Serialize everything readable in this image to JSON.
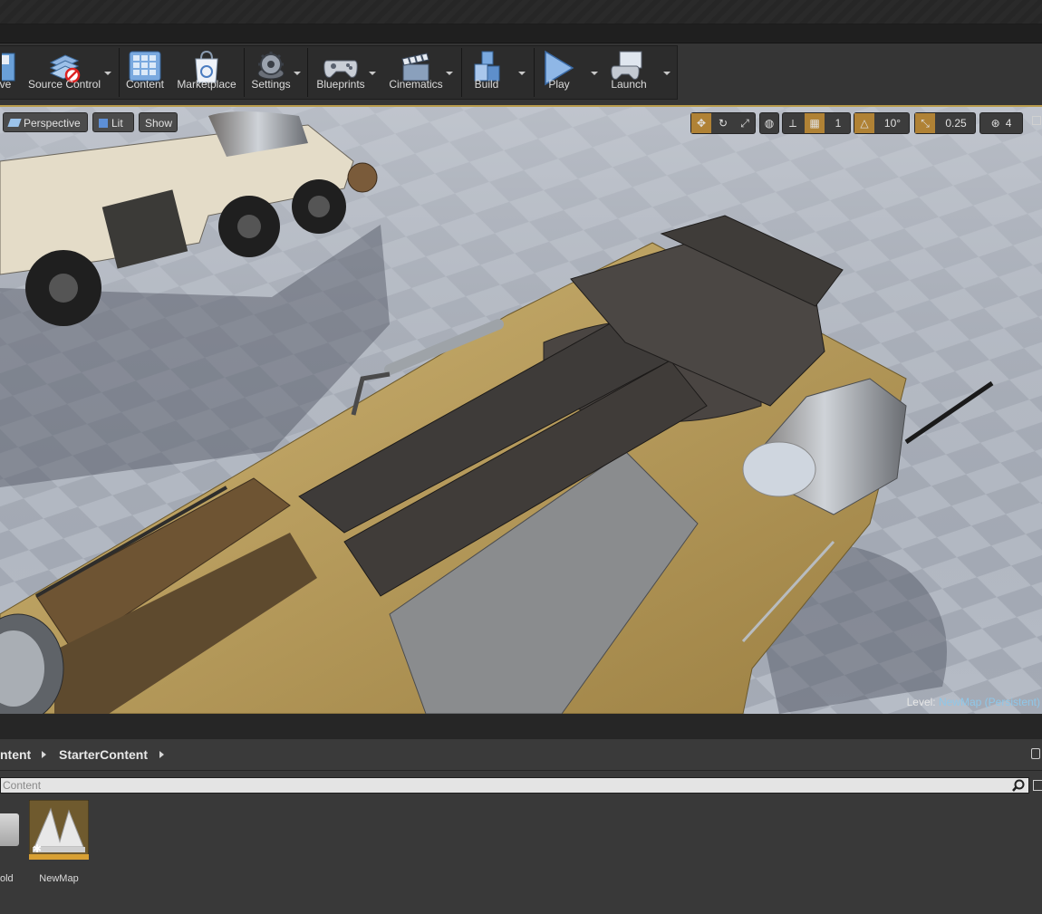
{
  "toolbar": {
    "items": [
      {
        "label": "ve",
        "icon": "save-icon"
      },
      {
        "label": "Source Control",
        "icon": "source-control-icon"
      },
      {
        "label": "Content",
        "icon": "content-icon"
      },
      {
        "label": "Marketplace",
        "icon": "marketplace-icon"
      },
      {
        "label": "Settings",
        "icon": "settings-gear-icon"
      },
      {
        "label": "Blueprints",
        "icon": "blueprints-gamepad-icon"
      },
      {
        "label": "Cinematics",
        "icon": "cinematics-clapper-icon"
      },
      {
        "label": "Build",
        "icon": "build-cubes-icon"
      },
      {
        "label": "Play",
        "icon": "play-icon"
      },
      {
        "label": "Launch",
        "icon": "launch-gamepad-icon"
      }
    ]
  },
  "viewport": {
    "view_mode_buttons": {
      "perspective": "Perspective",
      "lit": "Lit",
      "show": "Show"
    },
    "grid_snap": "1",
    "rotation_snap": "10°",
    "scale_snap": "0.25",
    "camera_speed": "4",
    "level_label": "Level:",
    "level_name": "NewMap (Persistent)"
  },
  "content_browser": {
    "breadcrumb": [
      "ntent",
      "StarterContent"
    ],
    "search_placeholder": "Content",
    "assets": [
      {
        "label": "old",
        "icon": "folder-icon"
      },
      {
        "label": "NewMap",
        "icon": "map-asset-icon"
      }
    ]
  },
  "colors": {
    "accent": "#b08235",
    "viewport_border": "#b89b4c",
    "level_name": "#8fc7e8"
  }
}
